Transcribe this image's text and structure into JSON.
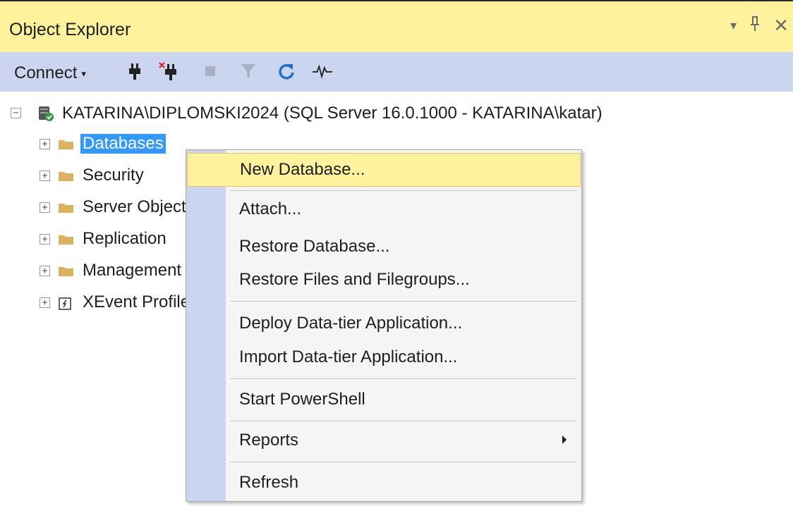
{
  "window": {
    "title": "Object Explorer",
    "controls": {
      "dropdown": "▾",
      "pin": "⊥",
      "close": "✕"
    }
  },
  "toolbar": {
    "connect_label": "Connect",
    "connect_caret": "▾",
    "icons": [
      "connect-plug-icon",
      "disconnect-plug-icon",
      "stop-icon",
      "filter-icon",
      "refresh-icon",
      "activity-monitor-icon"
    ]
  },
  "tree": {
    "server_label": "KATARINA\\DIPLOMSKI2024 (SQL Server 16.0.1000 - KATARINA\\katar)",
    "children": [
      {
        "label": "Databases",
        "icon": "folder-icon",
        "selected": true
      },
      {
        "label": "Security",
        "icon": "folder-icon"
      },
      {
        "label": "Server Objects",
        "icon": "folder-icon"
      },
      {
        "label": "Replication",
        "icon": "folder-icon"
      },
      {
        "label": "Management",
        "icon": "folder-icon"
      },
      {
        "label": "XEvent Profiler",
        "icon": "xevent-icon"
      }
    ]
  },
  "context_menu": {
    "items": [
      {
        "label": "New Database..."
      },
      {
        "label": "Attach..."
      },
      {
        "label": "Restore Database..."
      },
      {
        "label": "Restore Files and Filegroups..."
      },
      {
        "label": "Deploy Data-tier Application..."
      },
      {
        "label": "Import Data-tier Application..."
      },
      {
        "label": "Start PowerShell"
      },
      {
        "label": "Reports"
      },
      {
        "label": "Refresh"
      }
    ]
  },
  "colors": {
    "title_bar": "#fff29d",
    "toolbar": "#ccd5f0",
    "selection": "#3399ff",
    "menu_highlight": "#fff29d",
    "menu_gutter": "#ccd5f0",
    "folder": "#dcb35c"
  }
}
